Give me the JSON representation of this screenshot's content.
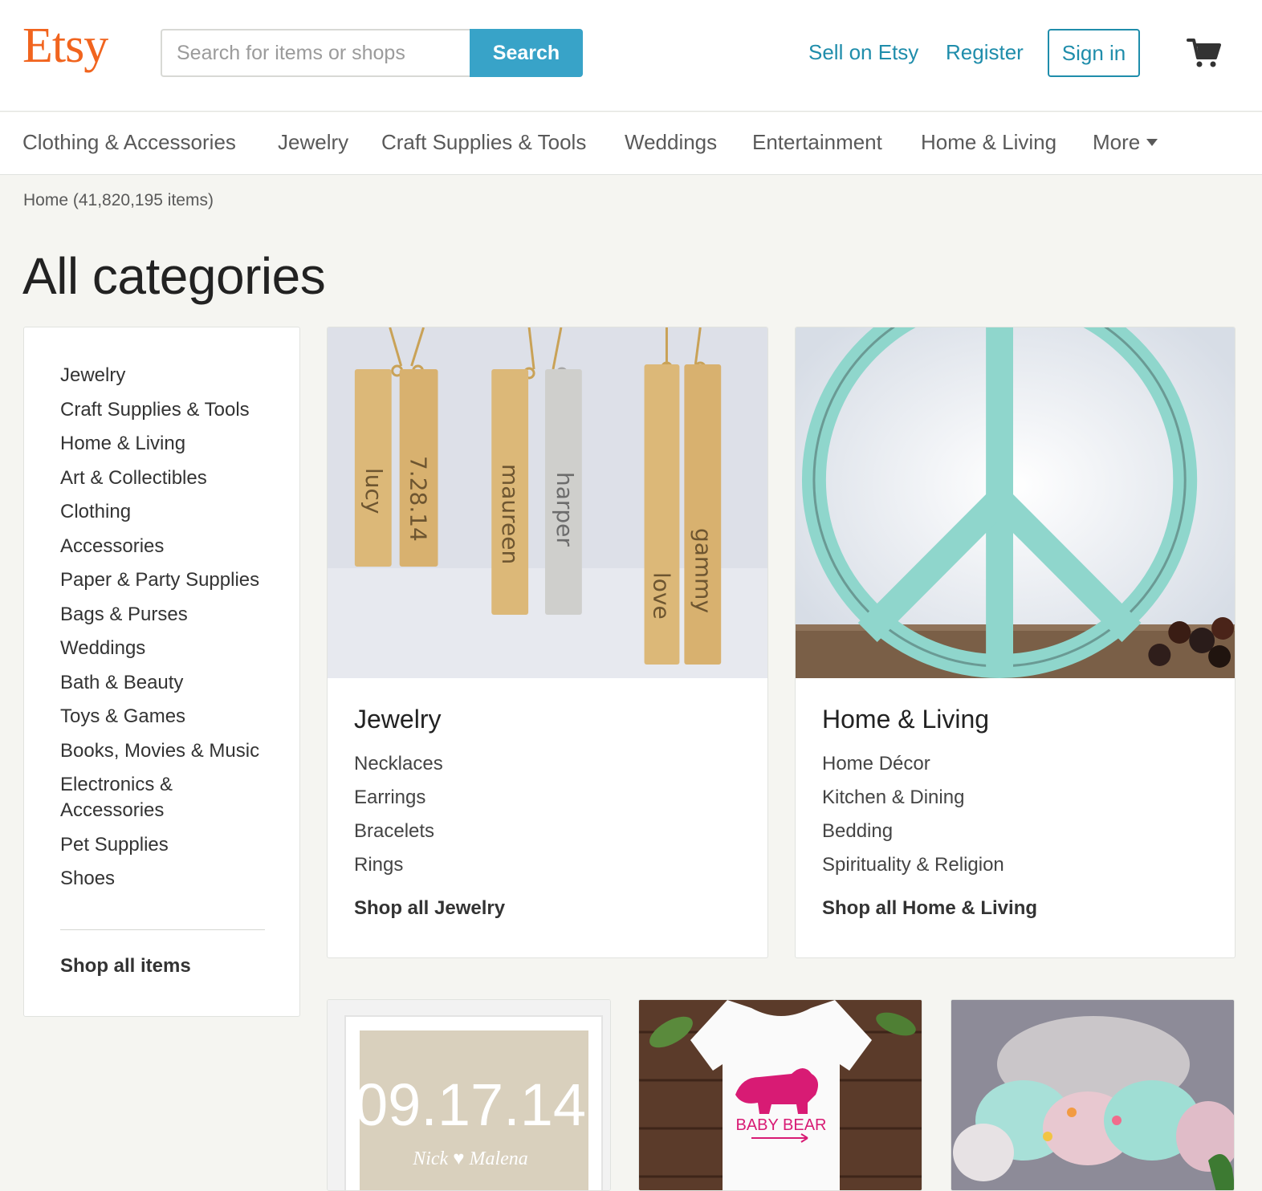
{
  "header": {
    "logo": "Etsy",
    "search_placeholder": "Search for items or shops",
    "search_label": "Search",
    "sell_label": "Sell on Etsy",
    "register_label": "Register",
    "signin_label": "Sign in",
    "cart_icon": "shopping-cart-icon"
  },
  "nav": {
    "items": [
      "Clothing & Accessories",
      "Jewelry",
      "Craft Supplies & Tools",
      "Weddings",
      "Entertainment",
      "Home & Living"
    ],
    "more_label": "More"
  },
  "breadcrumb": "Home (41,820,195 items)",
  "page_title": "All categories",
  "sidebar": {
    "items": [
      "Jewelry",
      "Craft Supplies & Tools",
      "Home & Living",
      "Art & Collectibles",
      "Clothing",
      "Accessories",
      "Paper & Party Supplies",
      "Bags & Purses",
      "Weddings",
      "Bath & Beauty",
      "Toys & Games",
      "Books, Movies & Music",
      "Electronics & Accessories",
      "Pet Supplies",
      "Shoes"
    ],
    "shop_all": "Shop all items"
  },
  "cards": [
    {
      "title": "Jewelry",
      "links": [
        "Necklaces",
        "Earrings",
        "Bracelets",
        "Rings"
      ],
      "shop_all": "Shop all Jewelry",
      "image_labels": [
        "lucy",
        "7.28.14",
        "maureen",
        "harper",
        "love",
        "gammy"
      ]
    },
    {
      "title": "Home & Living",
      "links": [
        "Home Décor",
        "Kitchen & Dining",
        "Bedding",
        "Spirituality & Religion"
      ],
      "shop_all": "Shop all Home & Living"
    }
  ],
  "tiles": {
    "print_date": "09.17.14",
    "print_names": "Nick ♥ Malena",
    "onesie_text": "BABY BEAR"
  },
  "colors": {
    "brand": "#f1641e",
    "link": "#1f8dab",
    "search_button": "#38a3c8",
    "background": "#f5f5f1"
  }
}
